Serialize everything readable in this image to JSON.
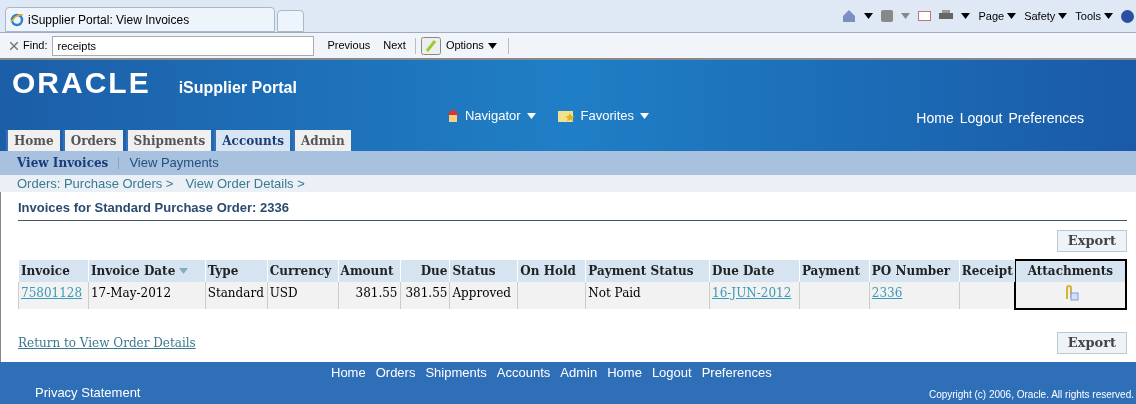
{
  "browser": {
    "tab_title": "iSupplier Portal: View Invoices",
    "commands": [
      "Page",
      "Safety",
      "Tools"
    ]
  },
  "find_bar": {
    "label": "Find:",
    "value": "receipts",
    "buttons": [
      "Previous",
      "Next"
    ],
    "options": "Options"
  },
  "header": {
    "logo": "ORACLE",
    "product": "iSupplier Portal",
    "menus": [
      "Navigator",
      "Favorites"
    ],
    "links": [
      "Home",
      "Logout",
      "Preferences"
    ]
  },
  "tabs": [
    {
      "label": "Home",
      "selected": false
    },
    {
      "label": "Orders",
      "selected": false
    },
    {
      "label": "Shipments",
      "selected": false
    },
    {
      "label": "Accounts",
      "selected": true
    },
    {
      "label": "Admin",
      "selected": false
    }
  ],
  "subtabs": [
    {
      "label": "View Invoices",
      "selected": true
    },
    {
      "label": "View Payments",
      "selected": false
    }
  ],
  "breadcrumbs": [
    "Orders: Purchase Orders >",
    "View Order Details >"
  ],
  "section_title": "Invoices for Standard Purchase Order: 2336",
  "export_buttons": [
    "Export",
    "Export"
  ],
  "table": {
    "columns": [
      {
        "label": "Invoice",
        "sorted": false,
        "highlighted": false
      },
      {
        "label": "Invoice Date",
        "sorted": true,
        "highlighted": false
      },
      {
        "label": "Type",
        "sorted": false,
        "highlighted": false
      },
      {
        "label": "Currency",
        "sorted": false,
        "highlighted": false
      },
      {
        "label": "Amount",
        "sorted": false,
        "highlighted": false
      },
      {
        "label": "Due",
        "sorted": false,
        "highlighted": false
      },
      {
        "label": "Status",
        "sorted": false,
        "highlighted": false
      },
      {
        "label": "On Hold",
        "sorted": false,
        "highlighted": false
      },
      {
        "label": "Payment Status",
        "sorted": false,
        "highlighted": false
      },
      {
        "label": "Due Date",
        "sorted": false,
        "highlighted": false
      },
      {
        "label": "Payment",
        "sorted": false,
        "highlighted": false
      },
      {
        "label": "PO Number",
        "sorted": false,
        "highlighted": false
      },
      {
        "label": "Receipt",
        "sorted": false,
        "highlighted": false
      },
      {
        "label": "Attachments",
        "sorted": false,
        "highlighted": true
      }
    ],
    "rows": [
      [
        {
          "kind": "link",
          "text": "75801128"
        },
        {
          "kind": "text",
          "text": "17-May-2012"
        },
        {
          "kind": "text",
          "text": "Standard"
        },
        {
          "kind": "text",
          "text": "USD"
        },
        {
          "kind": "number",
          "text": "381.55"
        },
        {
          "kind": "number",
          "text": "381.55"
        },
        {
          "kind": "text",
          "text": "Approved"
        },
        {
          "kind": "empty"
        },
        {
          "kind": "text",
          "text": "Not Paid"
        },
        {
          "kind": "link",
          "text": "16-JUN-2012"
        },
        {
          "kind": "empty"
        },
        {
          "kind": "link",
          "text": "2336"
        },
        {
          "kind": "empty"
        },
        {
          "kind": "attachment"
        }
      ]
    ]
  },
  "return_link": "Return to View Order Details",
  "footer": {
    "links": [
      "Home",
      "Orders",
      "Shipments",
      "Accounts",
      "Admin",
      "Home",
      "Logout",
      "Preferences"
    ],
    "privacy": "Privacy Statement",
    "copyright": "Copyright (c) 2006, Oracle. All rights reserved."
  }
}
